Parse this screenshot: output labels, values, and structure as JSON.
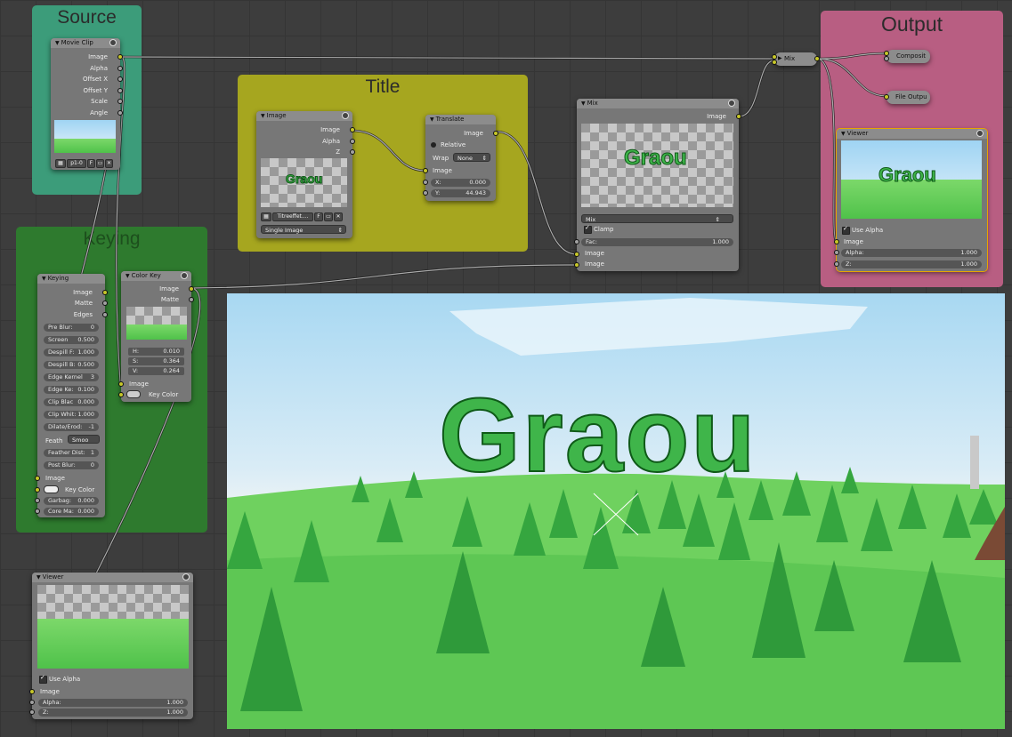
{
  "frames": {
    "source": "Source",
    "title": "Title",
    "keying": "Keying",
    "output": "Output"
  },
  "colors": {
    "source_frame": "#3c9c7a",
    "title_frame": "#a6a61f",
    "keying_frame": "#2e7a2e",
    "output_frame": "#b85e82",
    "socket_image": "#c7c729",
    "socket_value": "#a1a1a1",
    "grass": "#5fcf55",
    "tree": "#3fb24a"
  },
  "movie_clip": {
    "header": "Movie Clip",
    "outputs": [
      "Image",
      "Alpha",
      "Offset X",
      "Offset Y",
      "Scale",
      "Angle"
    ],
    "clip_name": "p1-0",
    "fake_user": "F"
  },
  "image_node": {
    "header": "Image",
    "outputs": [
      "Image",
      "Alpha",
      "Z"
    ],
    "thumb_text": "Graou",
    "image_name": "Titreeffet....",
    "fake_user": "F",
    "source_type": "Single Image"
  },
  "translate_node": {
    "header": "Translate",
    "output": "Image",
    "relative": "Relative",
    "wrap_label": "Wrap",
    "wrap_value": "None",
    "input_image": "Image",
    "x_label": "X:",
    "x_value": "0.000",
    "y_label": "Y:",
    "y_value": "44.943"
  },
  "mix_node_1": {
    "header": "Mix",
    "output": "Image",
    "thumb_text": "Graou",
    "blend": "Mix",
    "clamp": "Clamp",
    "fac_label": "Fac:",
    "fac_value": "1.000",
    "in1": "Image",
    "in2": "Image"
  },
  "mix_node_2": {
    "header": "Mix"
  },
  "composite": {
    "label": "Composit"
  },
  "file_output": {
    "label": "File Outpu"
  },
  "viewer_out": {
    "header": "Viewer",
    "thumb_text": "Graou",
    "use_alpha": "Use Alpha",
    "image": "Image",
    "alpha_label": "Alpha:",
    "alpha_value": "1.000",
    "z_label": "Z:",
    "z_value": "1.000"
  },
  "keying_node": {
    "header": "Keying",
    "outputs": [
      "Image",
      "Matte",
      "Edges"
    ],
    "fields": [
      {
        "label": "Pre Blur:",
        "value": "0"
      },
      {
        "label": "Screen",
        "value": "0.500"
      },
      {
        "label": "Despill F:",
        "value": "1.000"
      },
      {
        "label": "Despill B:",
        "value": "0.500"
      },
      {
        "label": "Edge Kernel",
        "value": "3"
      },
      {
        "label": "Edge Ke:",
        "value": "0.100"
      },
      {
        "label": "Clip Blac",
        "value": "0.000"
      },
      {
        "label": "Clip Whit:",
        "value": "1.000"
      },
      {
        "label": "Dilate/Erod:",
        "value": "-1"
      }
    ],
    "feather_label": "Feath",
    "feather_value": "Smoo",
    "feather_dist_label": "Feather Dist:",
    "feather_dist_value": "1",
    "post_blur_label": "Post Blur:",
    "post_blur_value": "0",
    "input_image": "Image",
    "key_color": "Key Color",
    "garbage_label": "Garbag:",
    "garbage_value": "0.000",
    "core_label": "Core Ma:",
    "core_value": "0.000"
  },
  "color_key_node": {
    "header": "Color Key",
    "outputs": [
      "Image",
      "Matte"
    ],
    "h_label": "H:",
    "h_value": "0.010",
    "s_label": "S:",
    "s_value": "0.364",
    "v_label": "V:",
    "v_value": "0.264",
    "input_image": "Image",
    "key_color": "Key Color"
  },
  "viewer_left": {
    "header": "Viewer",
    "use_alpha": "Use Alpha",
    "image": "Image",
    "alpha_label": "Alpha:",
    "alpha_value": "1.000",
    "z_label": "Z:",
    "z_value": "1.000"
  },
  "backdrop": {
    "title_text": "Graou"
  }
}
